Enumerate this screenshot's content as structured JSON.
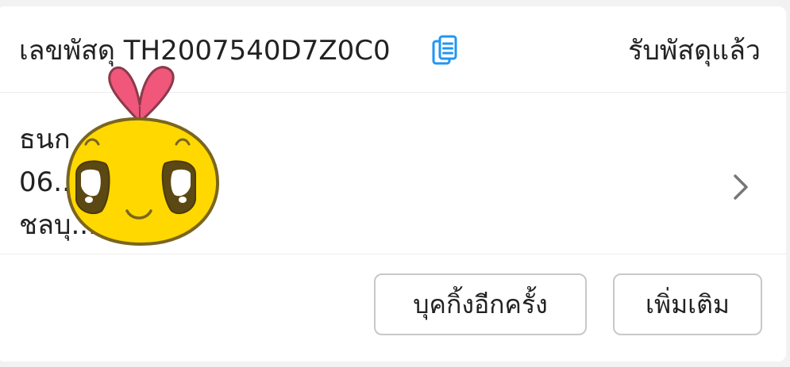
{
  "parcel": {
    "tracking_label": "เลขพัสดุ",
    "tracking_number": "TH2007540D7Z0C0",
    "status": "รับพัสดุแล้ว",
    "copy_icon": "copy-icon",
    "accent_color": "#2196f3"
  },
  "recipient": {
    "name": "ธนก ... รปิฎก",
    "phone": "06...",
    "location": "ชลบุ..."
  },
  "actions": {
    "rebook_label": "บุคกิ้งอีกครั้ง",
    "more_label": "เพิ่มเติม"
  },
  "icons": {
    "chevron": "chevron-right-icon",
    "sticker": "yellow-mascot-sticker"
  }
}
